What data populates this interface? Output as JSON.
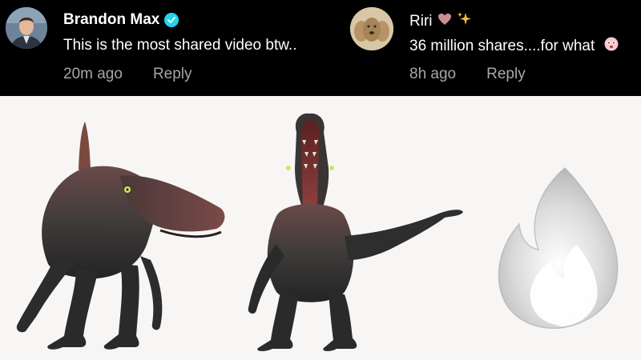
{
  "comments": [
    {
      "author": "Brandon Max",
      "verified": true,
      "text": "This is the most shared video btw..",
      "time": "20m ago",
      "reply_label": "Reply"
    },
    {
      "author": "Riri",
      "author_emojis": [
        "heart-icon",
        "sparkles-icon"
      ],
      "text": "36 million shares....for what",
      "text_emoji": "flushed-face-icon",
      "time": "8h ago",
      "reply_label": "Reply"
    }
  ],
  "colors": {
    "background_top": "#000000",
    "text_primary": "#ffffff",
    "text_secondary": "#a7a7a7",
    "verified_badge": "#20d5ec",
    "heart": "#c98f8f",
    "sparkles": "#f3c640"
  },
  "scene": {
    "elements": [
      "spinosaurus-side-view",
      "spinosaurus-front-view-pointing",
      "fire-icon-gray"
    ]
  }
}
